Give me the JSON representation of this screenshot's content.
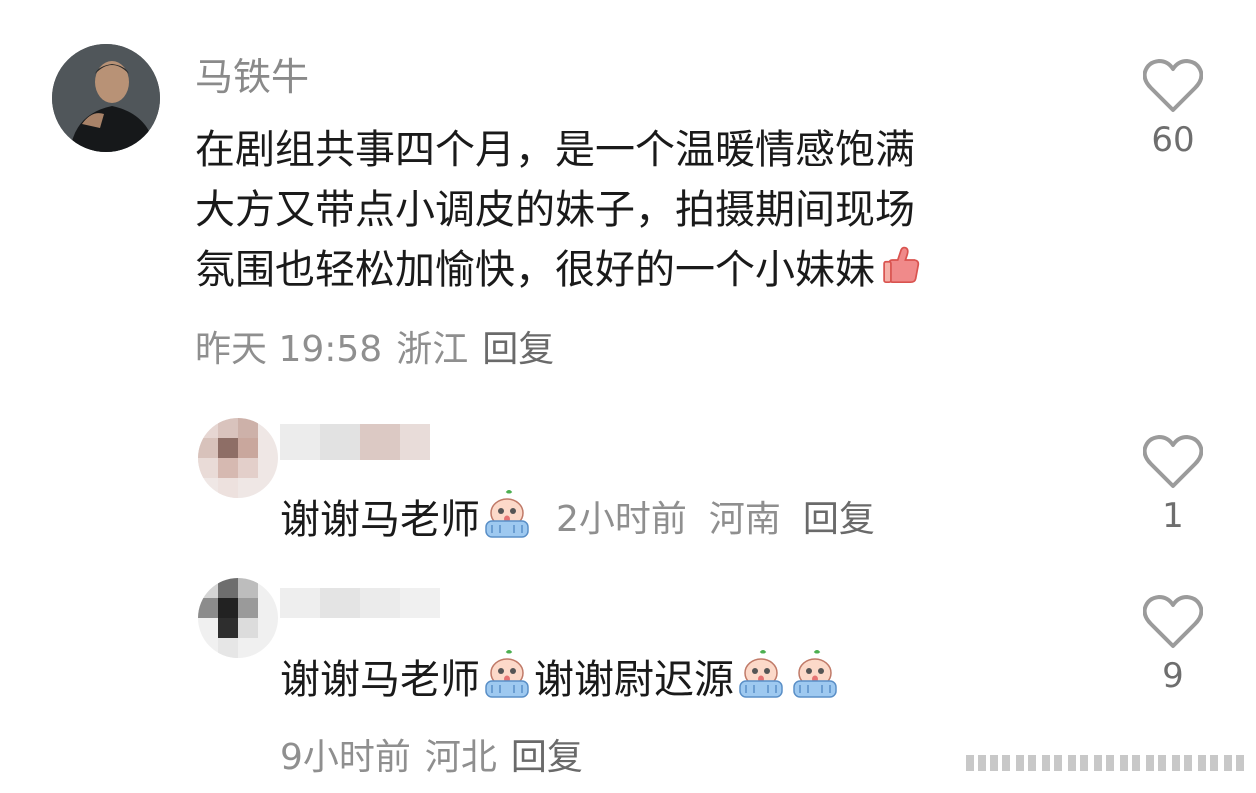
{
  "main_comment": {
    "username": "马铁牛",
    "text_lines": [
      "在剧组共事四个月，是一个温暖情感饱满",
      "大方又带点小调皮的妹子，拍摄期间现场",
      "氛围也轻松加愉快，很好的一个小妹妹"
    ],
    "emoji_thumb": "thumbs-up-icon",
    "time": "昨天 19:58",
    "location": "浙江",
    "reply_label": "回复",
    "likes": "60"
  },
  "replies": [
    {
      "text_a": "谢谢马老师",
      "time": "2小时前",
      "location": "河南",
      "reply_label": "回复",
      "likes": "1"
    },
    {
      "text_a": "谢谢马老师",
      "text_b": "谢谢尉迟源",
      "time": "9小时前",
      "location": "河北",
      "reply_label": "回复",
      "likes": "9"
    }
  ],
  "colors": {
    "text": "#1a1a1a",
    "meta": "#8f8f8f",
    "username": "#8a8a8a",
    "heart": "#9b9b9b"
  }
}
